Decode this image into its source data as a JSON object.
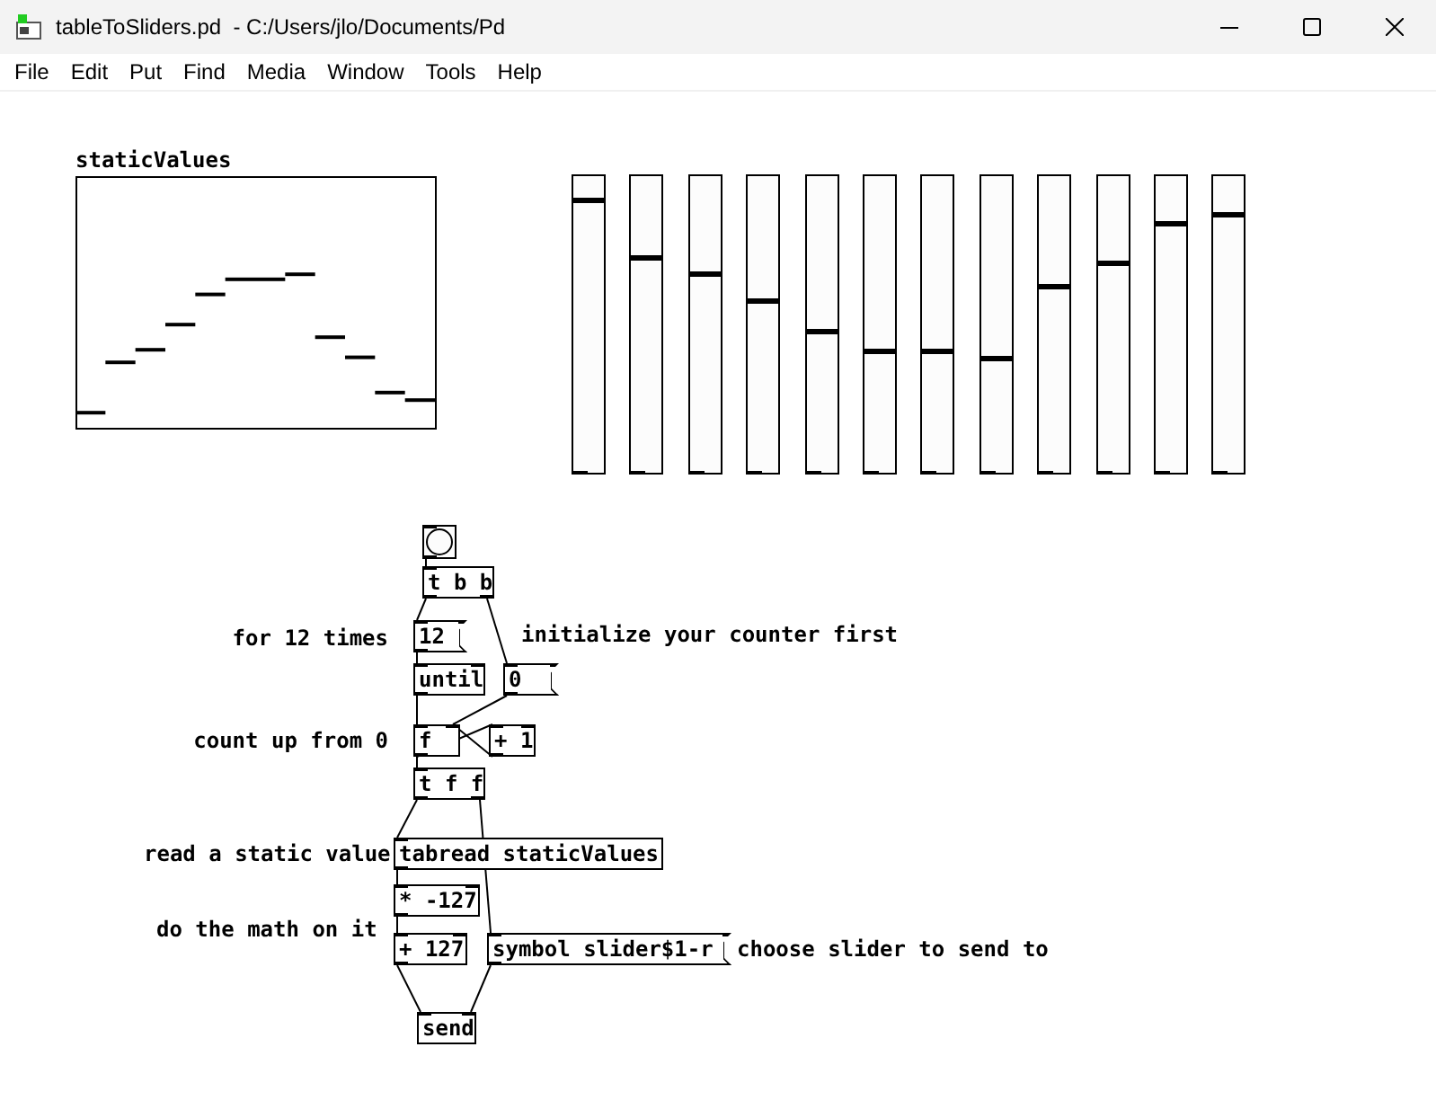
{
  "window": {
    "title": "tableToSliders.pd  - C:/Users/jlo/Documents/Pd"
  },
  "menu": [
    "File",
    "Edit",
    "Put",
    "Find",
    "Media",
    "Window",
    "Tools",
    "Help"
  ],
  "array": {
    "name": "staticValues"
  },
  "sliders": [
    {
      "level": 0.92
    },
    {
      "level": 0.73
    },
    {
      "level": 0.67
    },
    {
      "level": 0.58
    },
    {
      "level": 0.48
    },
    {
      "level": 0.41
    },
    {
      "level": 0.41
    },
    {
      "level": 0.39
    },
    {
      "level": 0.63
    },
    {
      "level": 0.71
    },
    {
      "level": 0.84
    },
    {
      "level": 0.87
    }
  ],
  "objects": [
    {
      "kind": "bang"
    },
    {
      "kind": "object",
      "text": "t b b"
    },
    {
      "kind": "message",
      "text": "12"
    },
    {
      "kind": "object",
      "text": "until"
    },
    {
      "kind": "message",
      "text": "0"
    },
    {
      "kind": "object",
      "text": "f"
    },
    {
      "kind": "object",
      "text": "+ 1"
    },
    {
      "kind": "object",
      "text": "t f f"
    },
    {
      "kind": "object",
      "text": "tabread staticValues"
    },
    {
      "kind": "object",
      "text": "* -127"
    },
    {
      "kind": "object",
      "text": "+ 127"
    },
    {
      "kind": "message",
      "text": "symbol slider$1-r"
    },
    {
      "kind": "object",
      "text": "send"
    }
  ],
  "comments": [
    "for 12 times",
    "initialize your counter first",
    "count up from 0",
    "read a static value",
    "do the math on it",
    "choose slider to send to"
  ]
}
